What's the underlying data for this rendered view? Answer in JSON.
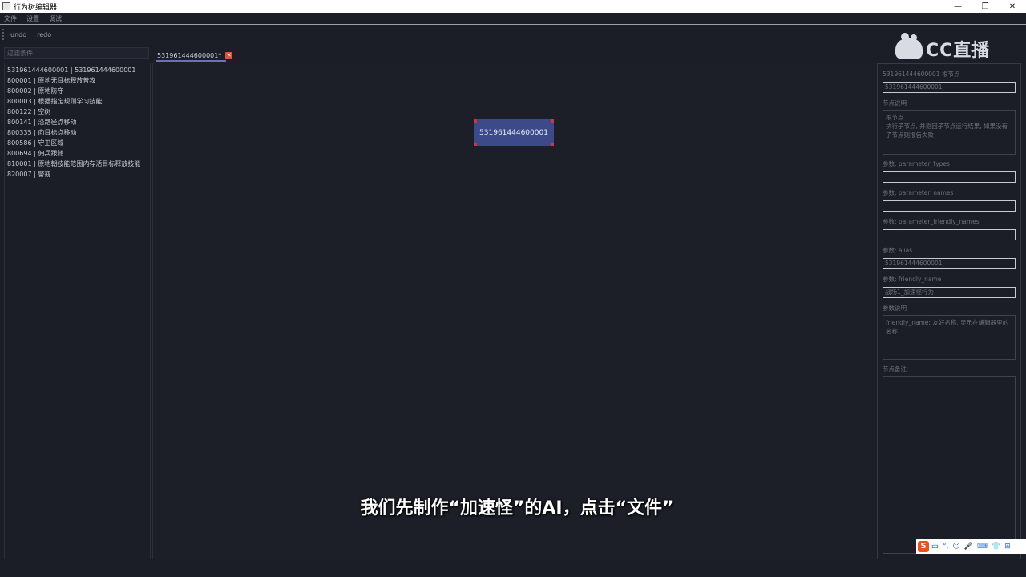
{
  "window": {
    "title": "行为树编辑器",
    "controls": [
      "—",
      "❐",
      "✕"
    ]
  },
  "menu": [
    "文件",
    "设置",
    "调试"
  ],
  "toolbar": {
    "undo": "undo",
    "redo": "redo"
  },
  "left": {
    "filter_placeholder": "过滤条件",
    "items": [
      "531961444600001 | 531961444600001",
      "800001 | 原地无目标释放普攻",
      "800002 | 原地防守",
      "800003 | 根据指定规则学习技能",
      "800122 | 空树",
      "800141 | 沿路径点移动",
      "800335 | 向目标点移动",
      "800586 | 守卫区域",
      "800694 | 佣兵跟随",
      "810001 | 原地朝技能范围内存活目标释放技能",
      "820007 | 警戒"
    ]
  },
  "tab": {
    "label": "531961444600001*",
    "close": "✕"
  },
  "node": {
    "label": "531961444600001"
  },
  "right": {
    "header": "531961444600001 根节点",
    "id_value": "531961444600001",
    "desc_label": "节点说明",
    "desc_text": "根节点\n执行子节点, 并返回子节点运行结果, 如果没有子节点则报告失败",
    "param1_label": "参数: parameter_types",
    "param1_value": "",
    "param2_label": "参数: parameter_names",
    "param2_value": "",
    "param3_label": "参数: parameter_friendly_names",
    "param3_value": "",
    "param4_label": "参数: alias",
    "param4_value": "531961444600001",
    "param5_label": "参数: friendly_name",
    "param5_value": "战场1_加速怪行为",
    "param_desc_label": "参数说明",
    "param_desc_text": "friendly_name: 友好名称, 显示在编辑器里的名称",
    "note_label": "节点备注",
    "note_text": ""
  },
  "watermark": {
    "text": "CC直播"
  },
  "subtitle": "我们先制作“加速怪”的AI，点击“文件”",
  "ime": {
    "logo": "S",
    "glyphs": [
      "中",
      "°,",
      "☺",
      "🎤",
      "⌨",
      "👕",
      "⊞"
    ]
  }
}
